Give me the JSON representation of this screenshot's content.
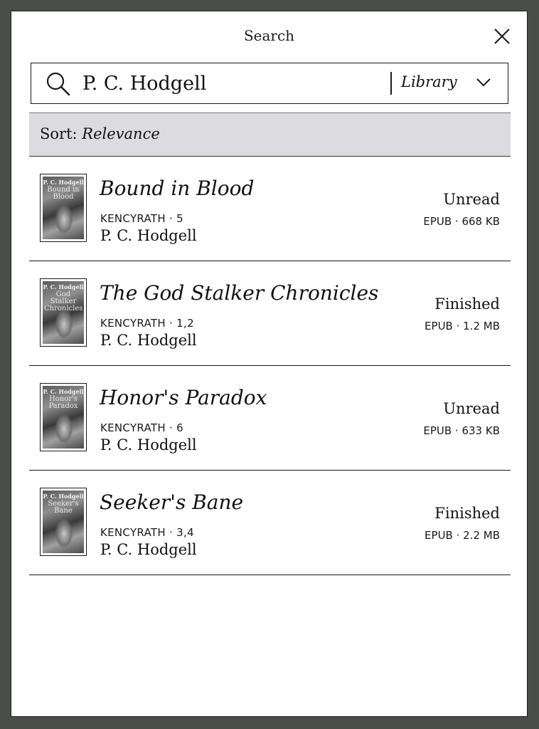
{
  "dialog": {
    "title": "Search",
    "close_icon": "close-icon"
  },
  "search": {
    "query": "P. C. Hodgell",
    "icon": "search-icon",
    "scope": "Library",
    "scope_icon": "chevron-down-icon"
  },
  "sort": {
    "label": "Sort:",
    "value": "Relevance"
  },
  "results": [
    {
      "title": "Bound in Blood",
      "series": "KENCYRATH · 5",
      "author": "P. C. Hodgell",
      "status": "Unread",
      "meta": "EPUB · 668 KB",
      "cover_author": "P. C. Hodgell",
      "cover_title": "Bound in Blood"
    },
    {
      "title": "The God Stalker Chronicles",
      "series": "KENCYRATH · 1,2",
      "author": "P. C. Hodgell",
      "status": "Finished",
      "meta": "EPUB · 1.2 MB",
      "cover_author": "P. C. Hodgell",
      "cover_title": "God Stalker Chronicles"
    },
    {
      "title": "Honor's Paradox",
      "series": "KENCYRATH · 6",
      "author": "P. C. Hodgell",
      "status": "Unread",
      "meta": "EPUB · 633 KB",
      "cover_author": "P. C. Hodgell",
      "cover_title": "Honor's Paradox"
    },
    {
      "title": "Seeker's Bane",
      "series": "KENCYRATH · 3,4",
      "author": "P. C. Hodgell",
      "status": "Finished",
      "meta": "EPUB · 2.2 MB",
      "cover_author": "P. C. Hodgell",
      "cover_title": "Seeker's Bane"
    }
  ]
}
